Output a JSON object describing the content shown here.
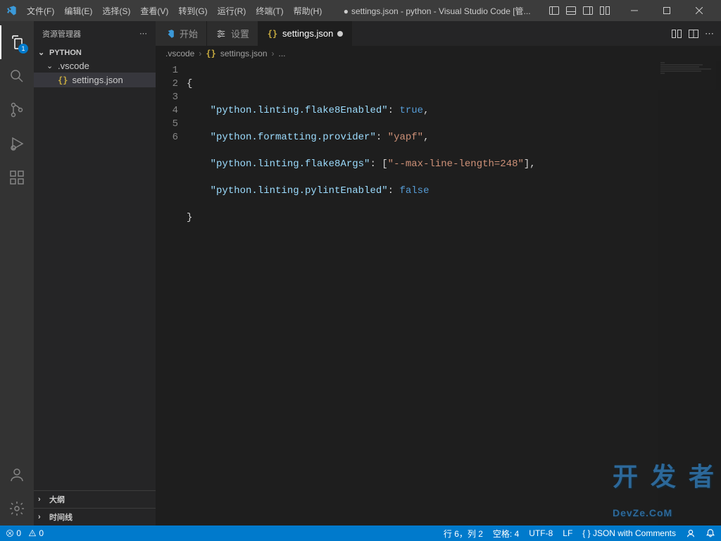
{
  "titlebar": {
    "menus": [
      "文件(F)",
      "编辑(E)",
      "选择(S)",
      "查看(V)",
      "转到(G)",
      "运行(R)",
      "终端(T)",
      "帮助(H)"
    ],
    "title_prefix": "●",
    "title": "settings.json - python - Visual Studio Code [管..."
  },
  "activitybar": {
    "explorer_badge": "1"
  },
  "sidebar": {
    "title": "资源管理器",
    "root": "PYTHON",
    "folder": ".vscode",
    "file": "settings.json",
    "outline": "大纲",
    "timeline": "时间线"
  },
  "tabs": {
    "t0": {
      "label": "开始"
    },
    "t1": {
      "label": "设置"
    },
    "t2": {
      "label": "settings.json"
    }
  },
  "breadcrumb": {
    "seg0": ".vscode",
    "seg1": "settings.json",
    "more": "..."
  },
  "editor": {
    "line_numbers": [
      "1",
      "2",
      "3",
      "4",
      "5",
      "6"
    ],
    "json_settings": {
      "python.linting.flake8Enabled": true,
      "python.formatting.provider": "yapf",
      "python.linting.flake8Args": [
        "--max-line-length=248"
      ],
      "python.linting.pylintEnabled": false
    },
    "code": {
      "l1": "{",
      "l2_k": "\"python.linting.flake8Enabled\"",
      "l2_v": "true",
      "l3_k": "\"python.formatting.provider\"",
      "l3_v": "\"yapf\"",
      "l4_k": "\"python.linting.flake8Args\"",
      "l4_v": "\"--max-line-length=248\"",
      "l5_k": "\"python.linting.pylintEnabled\"",
      "l5_v": "false",
      "l6": "}"
    }
  },
  "statusbar": {
    "errors": "0",
    "warnings": "0",
    "cursor": "行 6，列 2",
    "spaces": "空格: 4",
    "encoding": "UTF-8",
    "eol": "LF",
    "lang": "{ } JSON with Comments"
  },
  "watermark": {
    "big": "开 发 者",
    "small": "DevZe.CoM"
  }
}
